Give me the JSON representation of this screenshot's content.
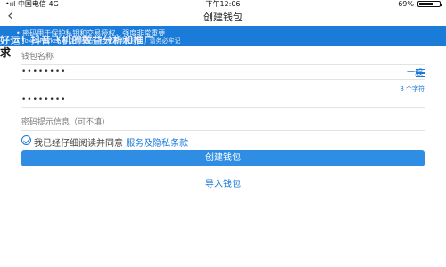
{
  "status_bar": {
    "carrier": "中国电信",
    "network": "4G",
    "time": "下午12:06",
    "battery": "69%",
    "battery_level": 0.69,
    "signal_glyph": "•ııl"
  },
  "nav": {
    "back_icon": "chevron-left-icon",
    "title": "创建钱包"
  },
  "notice": {
    "line1": "• 密码用于保护私钥和交易授权，强度非常重要",
    "line2": "• TokenPocket 不存储密码，也无法帮您找回，请务必牢记",
    "overlay": "好运！抖音飞机的效益分析和推广"
  },
  "stray_text": "求",
  "form": {
    "wallet_name_placeholder": "钱包名称",
    "password_value": "••••••••",
    "strength_label": "一般",
    "password_hint": "8 个字符",
    "repeat_password_value": "••••••••",
    "password_hint_placeholder": "密码提示信息（可不填）"
  },
  "agreement": {
    "prefix": "我已经仔细阅读并同意",
    "link": "服务及隐私条款"
  },
  "buttons": {
    "create": "创建钱包",
    "import": "导入钱包"
  },
  "colors": {
    "accent": "#1a7bd8",
    "button": "#2f8ee3"
  }
}
